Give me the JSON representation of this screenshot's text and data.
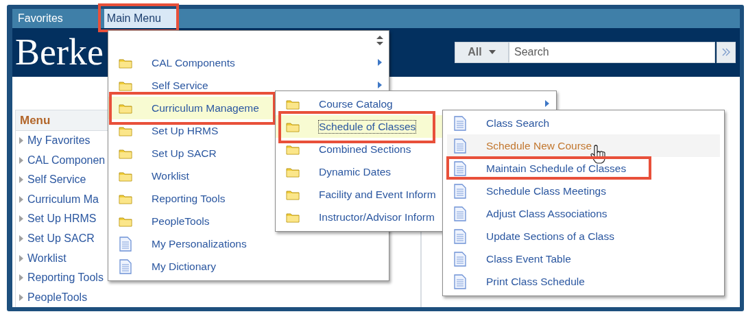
{
  "top_bar": {
    "items": [
      {
        "label": "Favorites",
        "selected": false
      },
      {
        "label": "Main Menu",
        "selected": true,
        "annotated": true
      }
    ]
  },
  "header": {
    "logo_text": "Berke",
    "search": {
      "scope": "All",
      "placeholder": "Search"
    }
  },
  "sidebar": {
    "title": "Menu",
    "items": [
      "My Favorites",
      "CAL Componen",
      "Self Service",
      "Curriculum Ma",
      "Set Up HRMS",
      "Set Up SACR",
      "Worklist",
      "Reporting Tools",
      "PeopleTools"
    ]
  },
  "menus": [
    {
      "items": [
        {
          "label": "CAL Components",
          "kind": "folder",
          "submenu": true,
          "selected": false
        },
        {
          "label": "Self Service",
          "kind": "folder",
          "submenu": true,
          "selected": false
        },
        {
          "label": "Curriculum Manageme",
          "kind": "folder",
          "selected": true,
          "annotated": true
        },
        {
          "label": "Set Up HRMS",
          "kind": "folder",
          "selected": false
        },
        {
          "label": "Set Up SACR",
          "kind": "folder",
          "selected": false
        },
        {
          "label": "Worklist",
          "kind": "folder",
          "selected": false
        },
        {
          "label": "Reporting Tools",
          "kind": "folder",
          "selected": false
        },
        {
          "label": "PeopleTools",
          "kind": "folder",
          "selected": false
        },
        {
          "label": "My Personalizations",
          "kind": "page",
          "selected": false
        },
        {
          "label": "My Dictionary",
          "kind": "page",
          "selected": false
        }
      ]
    },
    {
      "items": [
        {
          "label": "Course Catalog",
          "kind": "folder",
          "submenu": true,
          "selected": false
        },
        {
          "label": "Schedule of Classes",
          "kind": "folder",
          "selected": true,
          "annotated": true
        },
        {
          "label": "Combined Sections",
          "kind": "folder",
          "selected": false
        },
        {
          "label": "Dynamic Dates",
          "kind": "folder",
          "selected": false
        },
        {
          "label": "Facility and Event Inform",
          "kind": "folder",
          "selected": false
        },
        {
          "label": "Instructor/Advisor Inform",
          "kind": "folder",
          "selected": false
        }
      ]
    },
    {
      "items": [
        {
          "label": "Class Search",
          "kind": "page",
          "selected": false
        },
        {
          "label": "Schedule New Course",
          "kind": "page",
          "selected": false,
          "hovered": true
        },
        {
          "label": "Maintain Schedule of Classes",
          "kind": "page",
          "selected": false,
          "annotated": true
        },
        {
          "label": "Schedule Class Meetings",
          "kind": "page",
          "selected": false
        },
        {
          "label": "Adjust Class Associations",
          "kind": "page",
          "selected": false
        },
        {
          "label": "Update Sections of a Class",
          "kind": "page",
          "selected": false
        },
        {
          "label": "Class Event Table",
          "kind": "page",
          "selected": false
        },
        {
          "label": "Print Class Schedule",
          "kind": "page",
          "selected": false
        }
      ]
    }
  ]
}
